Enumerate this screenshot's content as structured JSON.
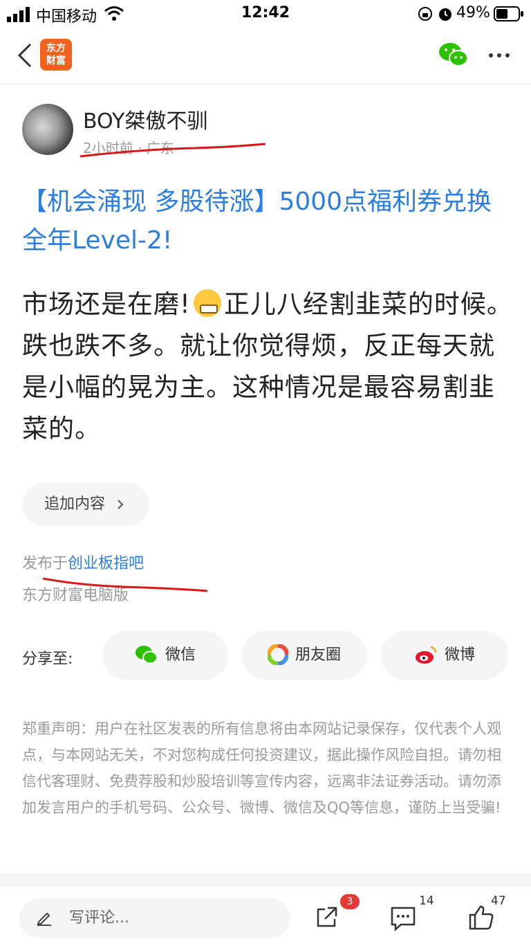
{
  "status_bar": {
    "carrier": "中国移动",
    "time": "12:42",
    "battery": "49%"
  },
  "nav": {
    "logo_line1": "东方",
    "logo_line2": "财富"
  },
  "author": {
    "name": "BOY桀傲不驯",
    "meta": "2小时前 · 广东"
  },
  "post": {
    "title": "【机会涌现 多股待涨】5000点福利券兑换全年Level-2!",
    "body_part1": "市场还是在磨!",
    "body_part2": "正儿八经割韭菜的时候。跌也跌不多。就让你觉得烦，反正每天就是小幅的晃为主。这种情况是最容易割韭菜的。",
    "more_label": "追加内容",
    "published_prefix": "发布于",
    "published_board": "创业板指吧",
    "source": "东方财富电脑版"
  },
  "share": {
    "label": "分享至:",
    "wechat": "微信",
    "moments": "朋友圈",
    "weibo": "微博"
  },
  "disclaimer": "郑重声明：用户在社区发表的所有信息将由本网站记录保存，仅代表个人观点，与本网站无关，不对您构成任何投资建议，据此操作风险自担。请勿相信代客理财、免费荐股和炒股培训等宣传内容，远离非法证券活动。请勿添加发言用户的手机号码、公众号、微博、微信及QQ等信息，谨防上当受骗!",
  "bottom": {
    "comment_placeholder": "写评论...",
    "share_count": "3",
    "comment_count": "14",
    "like_count": "47"
  },
  "colors": {
    "link": "#2b7de0",
    "brand": "#f2621f",
    "badge": "#e53935",
    "wechat_green": "#2dc100",
    "annotation_red": "#d61a1a"
  },
  "icons": [
    "signal-icon",
    "wifi-icon",
    "lock-rotation-icon",
    "alarm-icon",
    "battery-icon",
    "back-icon",
    "wechat-icon",
    "more-icon",
    "chevron-right-icon",
    "moments-icon",
    "weibo-icon",
    "pencil-icon",
    "share-out-icon",
    "comment-icon",
    "like-icon"
  ]
}
